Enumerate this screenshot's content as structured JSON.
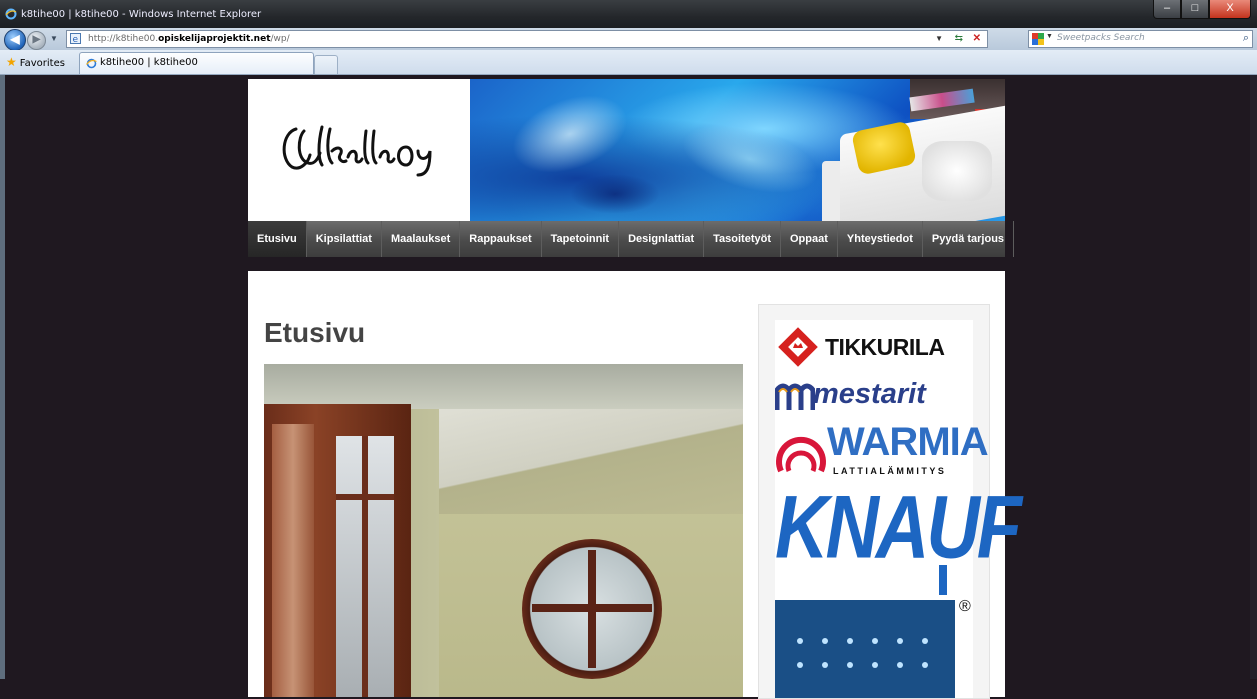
{
  "window": {
    "title": "k8tihe00 | k8tihe00 - Windows Internet Explorer",
    "controls": {
      "minimize": "–",
      "maximize": "□",
      "close": "X"
    }
  },
  "toolbar": {
    "back_glyph": "◀",
    "forward_glyph": "▶",
    "recent_glyph": "▼",
    "url_prefix": "http://k8tihe00.",
    "url_host": "opiskelijaprojektit.net",
    "url_suffix": "/wp/",
    "dropdown_glyph": "▼",
    "refresh_glyph": "⇆",
    "stop_glyph": "✕",
    "search_placeholder": "Sweetpacks Search",
    "search_dropdown_glyph": "▼",
    "search_go_glyph": "⌕"
  },
  "favorites": {
    "label": "Favorites",
    "star_glyph": "★",
    "tab_label": "k8tihe00 | k8tihe00"
  },
  "site": {
    "nav": [
      {
        "label": "Etusivu",
        "active": true
      },
      {
        "label": "Kipsilattiat",
        "active": false
      },
      {
        "label": "Maalaukset",
        "active": false
      },
      {
        "label": "Rappaukset",
        "active": false
      },
      {
        "label": "Tapetoinnit",
        "active": false
      },
      {
        "label": "Designlattiat",
        "active": false
      },
      {
        "label": "Tasoitetyöt",
        "active": false
      },
      {
        "label": "Oppaat",
        "active": false
      },
      {
        "label": "Yhteystiedot",
        "active": false
      },
      {
        "label": "Pyydä tarjous",
        "active": false
      }
    ],
    "page_title": "Etusivu",
    "brands": {
      "tikkurila": "TIKKURILA",
      "mestarit": "mestarit",
      "warmia": "WARMIA",
      "warmia_sub": "LATTIALÄMMITYS",
      "knauf": "KNAUF",
      "registered": "®"
    }
  },
  "colors": {
    "page_background": "#1f1820",
    "nav_background": "#4b4b4b",
    "title_text": "#444444",
    "warmia_blue": "#2f6ec3",
    "knauf_blue": "#1d66c2",
    "tikkurila_red": "#d6211e"
  }
}
